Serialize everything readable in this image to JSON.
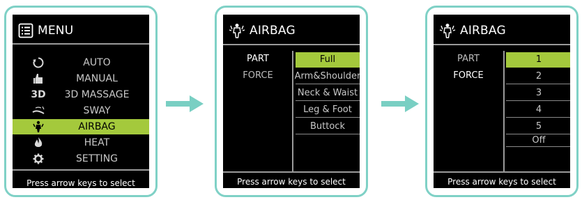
{
  "colors": {
    "frame": "#7fd1c6",
    "selection": "#a4c93c",
    "arrow": "#79cfc3"
  },
  "panel1": {
    "title": "MENU",
    "items": [
      {
        "label": "AUTO",
        "icon": "auto-cycle-icon"
      },
      {
        "label": "MANUAL",
        "icon": "thumbs-up-icon"
      },
      {
        "label": "3D MASSAGE",
        "icon": "3d-icon",
        "icon_text": "3D"
      },
      {
        "label": "SWAY",
        "icon": "sway-icon"
      },
      {
        "label": "AIRBAG",
        "icon": "airbag-icon",
        "selected": true
      },
      {
        "label": "HEAT",
        "icon": "flame-icon"
      },
      {
        "label": "SETTING",
        "icon": "gear-icon"
      }
    ],
    "footer": "Press arrow keys to select"
  },
  "panel2": {
    "title": "AIRBAG",
    "left": [
      {
        "label": "PART",
        "active": true
      },
      {
        "label": "FORCE",
        "active": false
      }
    ],
    "options": [
      {
        "label": "Full",
        "selected": true
      },
      {
        "label": "Arm&Shoulder"
      },
      {
        "label": "Neck & Waist"
      },
      {
        "label": "Leg & Foot"
      },
      {
        "label": "Buttock"
      }
    ],
    "footer": "Press arrow keys to select"
  },
  "panel3": {
    "title": "AIRBAG",
    "left": [
      {
        "label": "PART",
        "active": false
      },
      {
        "label": "FORCE",
        "active": true
      }
    ],
    "options": [
      {
        "label": "1",
        "selected": true
      },
      {
        "label": "2"
      },
      {
        "label": "3"
      },
      {
        "label": "4"
      },
      {
        "label": "5"
      },
      {
        "label": "Off"
      }
    ],
    "footer": "Press arrow keys to select"
  }
}
